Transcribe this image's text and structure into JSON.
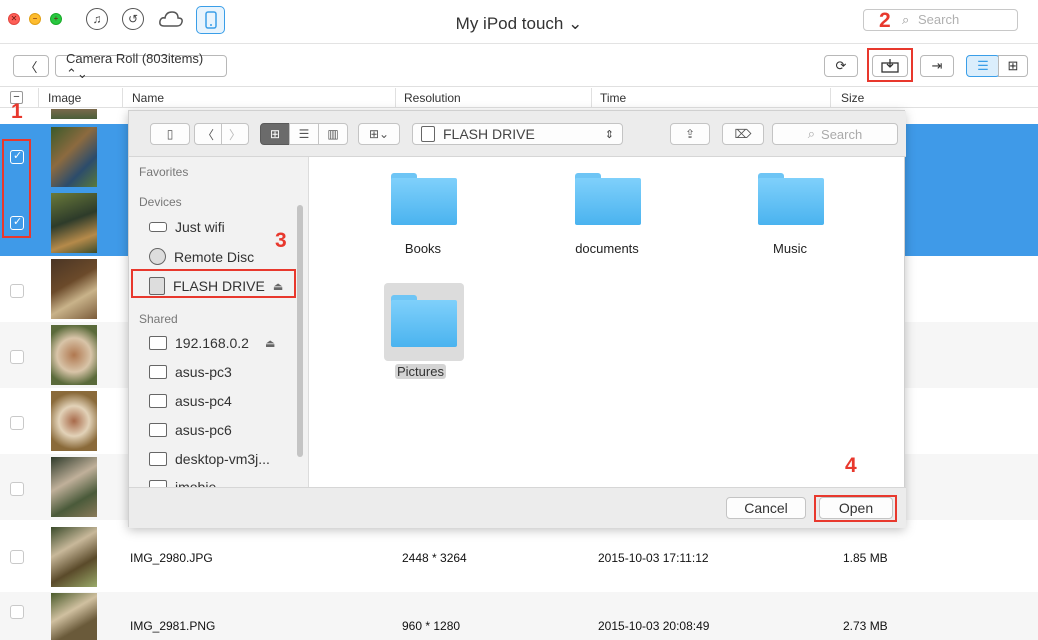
{
  "window": {
    "title": "My iPod touch ⌄",
    "search_placeholder": "Search"
  },
  "toolbar": {
    "album_select": "Camera Roll (803items) ⌃⌄"
  },
  "table": {
    "headers": [
      "Image",
      "Name",
      "Resolution",
      "Time",
      "Size"
    ],
    "rows": [
      {
        "name": "IMG_2980.JPG",
        "resolution": "2448 * 3264",
        "time": "2015-10-03 17:11:12",
        "size": "1.85 MB"
      },
      {
        "name": "IMG_2981.PNG",
        "resolution": "960 * 1280",
        "time": "2015-10-03 20:08:49",
        "size": "2.73 MB"
      }
    ]
  },
  "dialog": {
    "location": "FLASH DRIVE",
    "search_placeholder": "Search",
    "sidebar": {
      "favorites_head": "Favorites",
      "devices_head": "Devices",
      "devices": [
        "Just wifi",
        "Remote Disc",
        "FLASH DRIVE"
      ],
      "shared_head": "Shared",
      "shared": [
        "192.168.0.2",
        "asus-pc3",
        "asus-pc4",
        "asus-pc6",
        "desktop-vm3j...",
        "imobie"
      ]
    },
    "folders": [
      "Books",
      "documents",
      "Music",
      "Pictures"
    ],
    "cancel_label": "Cancel",
    "open_label": "Open"
  },
  "annotations": {
    "step1": "1",
    "step2": "2",
    "step3": "3",
    "step4": "4",
    "color": "#e8382d"
  },
  "colors": {
    "selection": "#3f9ae8",
    "folder": "#5bbff6"
  }
}
